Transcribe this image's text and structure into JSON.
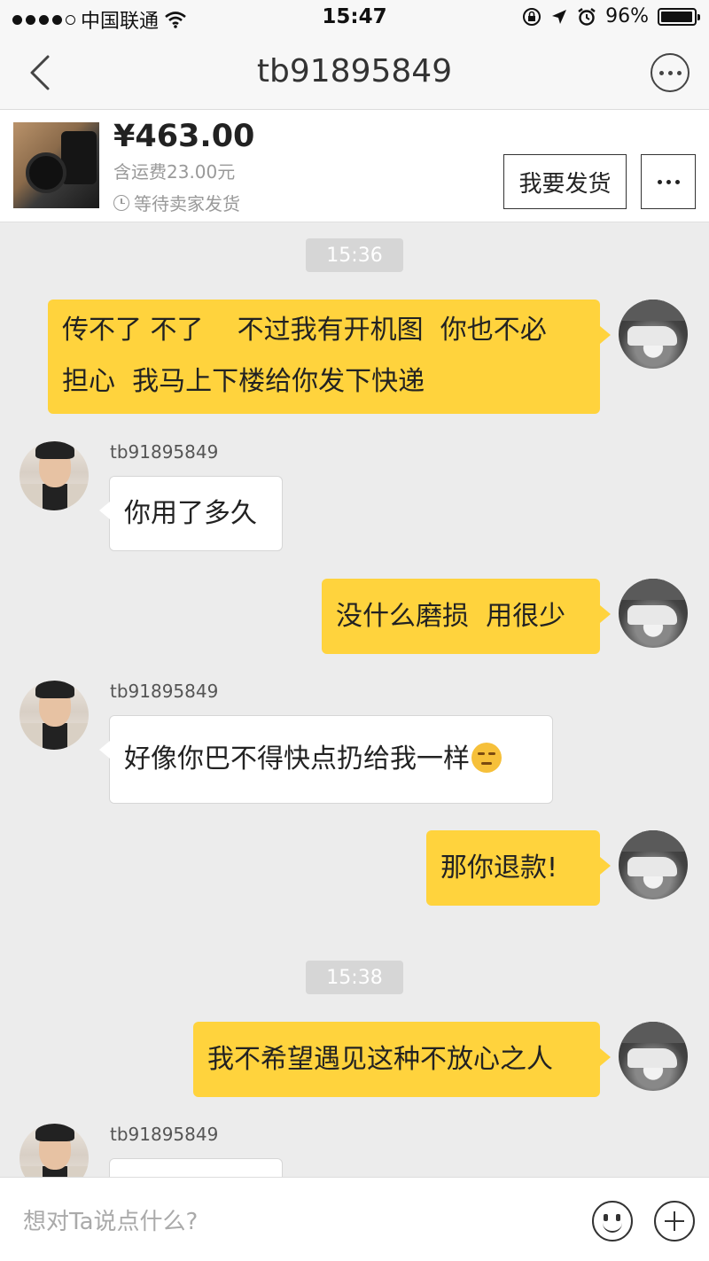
{
  "status_bar": {
    "carrier": "中国联通",
    "time": "15:47",
    "battery_percent": "96%",
    "battery_level": 0.96,
    "signal_dots_filled": 4,
    "signal_dots_total": 5,
    "icons": [
      "wifi-icon",
      "rotation-lock-icon",
      "location-icon",
      "alarm-icon",
      "battery-icon"
    ]
  },
  "nav": {
    "title": "tb91895849",
    "back_icon": "chevron-left-icon",
    "more_icon": "more-icon"
  },
  "order": {
    "price": "¥463.00",
    "shipping": "含运费23.00元",
    "status": "等待卖家发货",
    "ship_button": "我要发货",
    "more_icon": "more-icon"
  },
  "chat": {
    "time_1": "15:36",
    "time_2": "15:38",
    "messages": [
      {
        "side": "out",
        "text_line1": "传不了 不了    不过我有开机图  你也不必",
        "text_line2": "担心  我马上下楼给你发下快递"
      },
      {
        "side": "in",
        "sender": "tb91895849",
        "text": "你用了多久"
      },
      {
        "side": "out",
        "text": "没什么磨损  用很少"
      },
      {
        "side": "in",
        "sender": "tb91895849",
        "text": "好像你巴不得快点扔给我一样",
        "emoji": "unamused-emoji"
      },
      {
        "side": "out",
        "text": "那你退款!"
      },
      {
        "side": "out",
        "text": "我不希望遇见这种不放心之人"
      },
      {
        "side": "in",
        "sender": "tb91895849",
        "text": ""
      }
    ]
  },
  "input": {
    "placeholder": "想对Ta说点什么?",
    "emoji_icon": "smiley-icon",
    "plus_icon": "plus-icon"
  },
  "colors": {
    "outgoing_bubble": "#ffd33d",
    "incoming_bubble": "#ffffff",
    "chat_background": "#ececec"
  }
}
